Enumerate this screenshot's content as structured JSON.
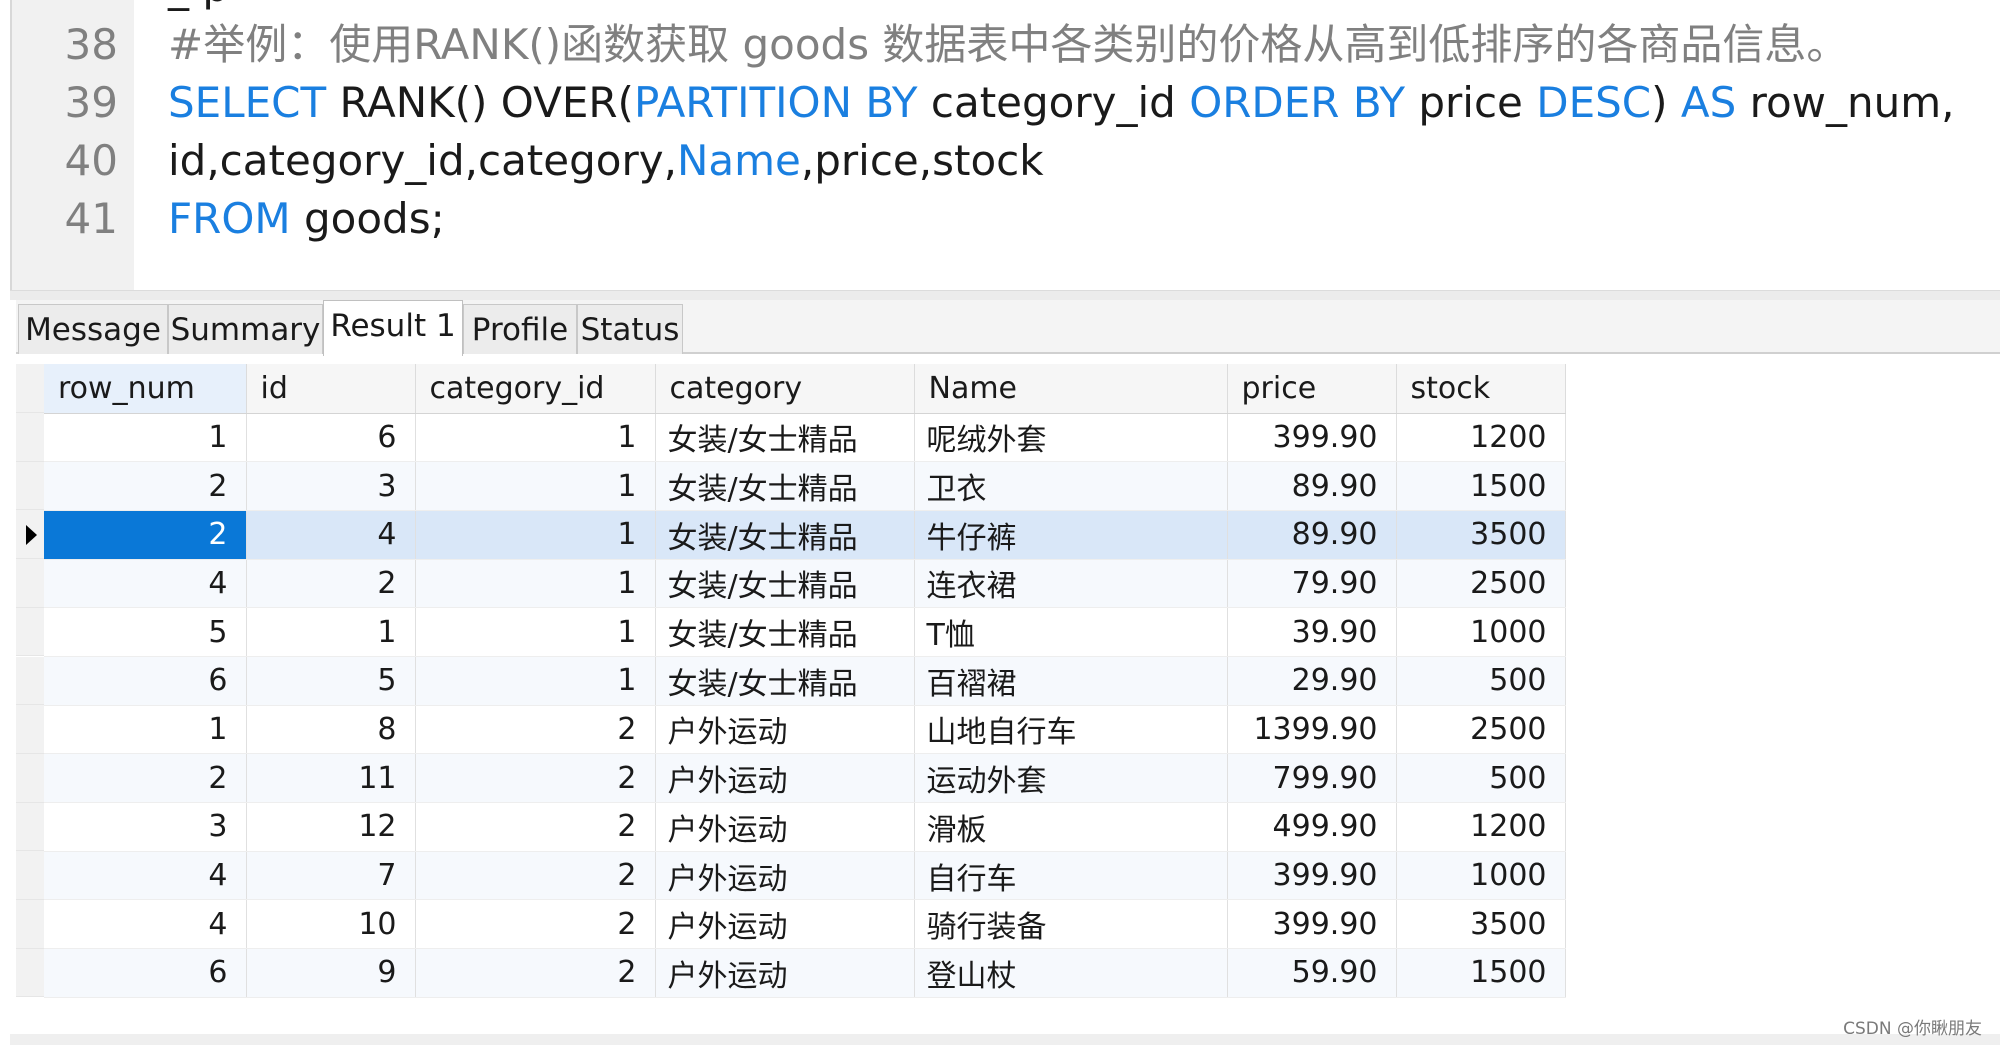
{
  "editor": {
    "partial_line": "           _      p",
    "lines": [
      {
        "no": "38",
        "parts": [
          {
            "t": "#举例：使用RANK()函数获取 goods 数据表中各类别的价格从高到低排序的各商品信息。",
            "c": "cm"
          }
        ]
      },
      {
        "no": "39",
        "parts": [
          {
            "t": "SELECT",
            "c": "kw"
          },
          {
            "t": " RANK() OVER(",
            "c": "tx"
          },
          {
            "t": "PARTITION BY",
            "c": "kw"
          },
          {
            "t": " category_id ",
            "c": "tx"
          },
          {
            "t": "ORDER BY",
            "c": "kw"
          },
          {
            "t": " price ",
            "c": "tx"
          },
          {
            "t": "DESC",
            "c": "kw"
          },
          {
            "t": ") ",
            "c": "tx"
          },
          {
            "t": "AS",
            "c": "kw"
          },
          {
            "t": " row_num,",
            "c": "tx"
          }
        ]
      },
      {
        "no": "40",
        "parts": [
          {
            "t": "id,category_id,category,",
            "c": "tx"
          },
          {
            "t": "Name",
            "c": "kw"
          },
          {
            "t": ",price,stock",
            "c": "tx"
          }
        ]
      },
      {
        "no": "41",
        "parts": [
          {
            "t": "FROM",
            "c": "kw"
          },
          {
            "t": " goods;",
            "c": "tx"
          }
        ]
      }
    ]
  },
  "tabs": [
    "Message",
    "Summary",
    "Result 1",
    "Profile",
    "Status"
  ],
  "active_tab": "Result 1",
  "grid": {
    "columns": [
      "row_num",
      "id",
      "category_id",
      "category",
      "Name",
      "price",
      "stock"
    ],
    "rows": [
      [
        "1",
        "6",
        "1",
        "女装/女士精品",
        "呢绒外套",
        "399.90",
        "1200"
      ],
      [
        "2",
        "3",
        "1",
        "女装/女士精品",
        "卫衣",
        "89.90",
        "1500"
      ],
      [
        "2",
        "4",
        "1",
        "女装/女士精品",
        "牛仔裤",
        "89.90",
        "3500"
      ],
      [
        "4",
        "2",
        "1",
        "女装/女士精品",
        "连衣裙",
        "79.90",
        "2500"
      ],
      [
        "5",
        "1",
        "1",
        "女装/女士精品",
        "T恤",
        "39.90",
        "1000"
      ],
      [
        "6",
        "5",
        "1",
        "女装/女士精品",
        "百褶裙",
        "29.90",
        "500"
      ],
      [
        "1",
        "8",
        "2",
        "户外运动",
        "山地自行车",
        "1399.90",
        "2500"
      ],
      [
        "2",
        "11",
        "2",
        "户外运动",
        "运动外套",
        "799.90",
        "500"
      ],
      [
        "3",
        "12",
        "2",
        "户外运动",
        "滑板",
        "499.90",
        "1200"
      ],
      [
        "4",
        "7",
        "2",
        "户外运动",
        "自行车",
        "399.90",
        "1000"
      ],
      [
        "4",
        "10",
        "2",
        "户外运动",
        "骑行装备",
        "399.90",
        "3500"
      ],
      [
        "6",
        "9",
        "2",
        "户外运动",
        "登山杖",
        "59.90",
        "1500"
      ]
    ],
    "selected_row": 2,
    "colors": {
      "selection": "#0a78d7",
      "selected_row": "#d9e7f8",
      "keyword": "#1a7fe0"
    }
  },
  "watermark": "CSDN @你瞅朋友"
}
